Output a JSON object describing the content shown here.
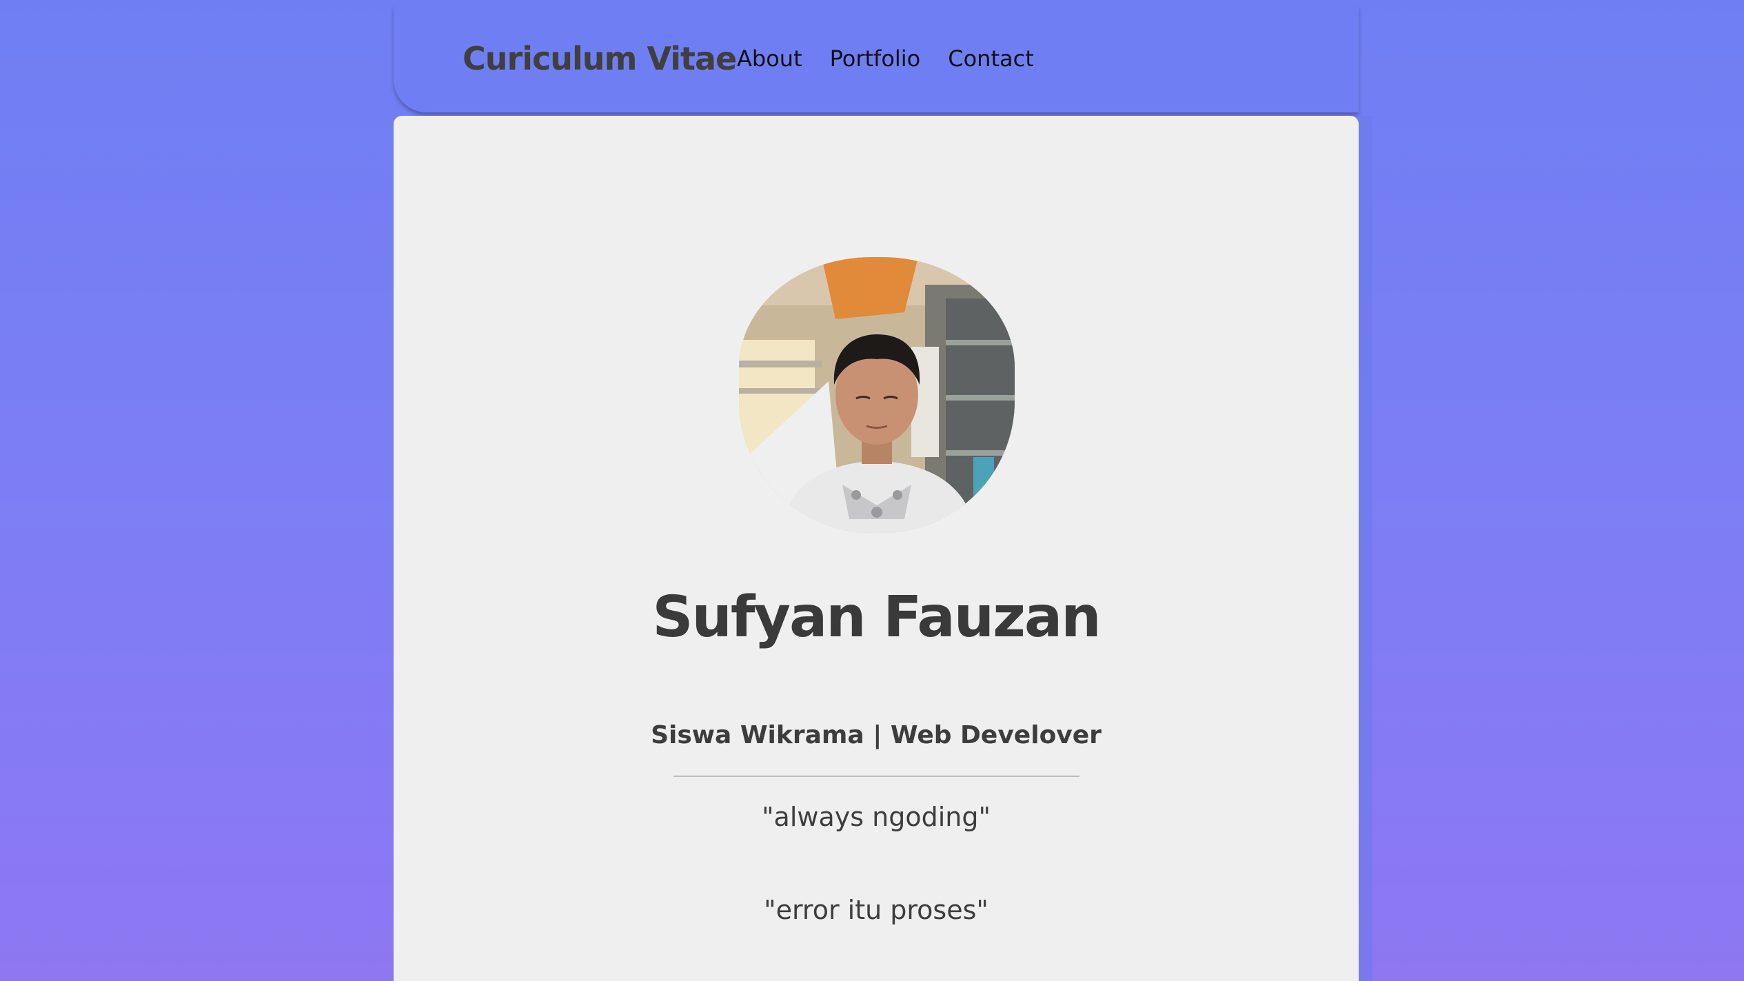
{
  "header": {
    "brand": "Curiculum Vitae",
    "nav": [
      "About",
      "Portfolio",
      "Contact"
    ]
  },
  "profile": {
    "name": "Sufyan Fauzan",
    "subtitle": "Siswa Wikrama | Web Develover",
    "quotes": [
      "\"always ngoding\"",
      "\"error itu proses\""
    ]
  },
  "colors": {
    "background": "#7b7ff4",
    "nav": "#6f7ff3",
    "card": "#efefef",
    "text": "#3d3d3d"
  }
}
